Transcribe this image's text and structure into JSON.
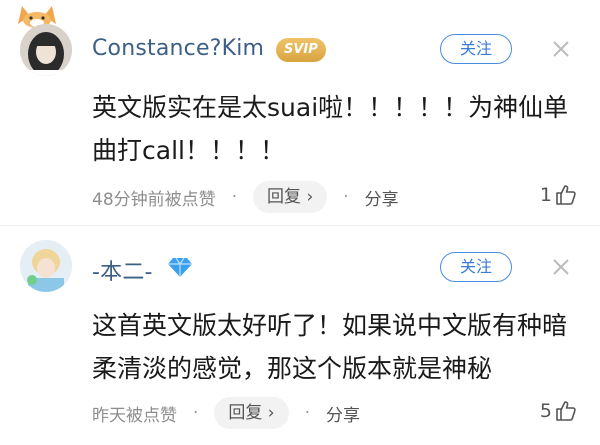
{
  "comments": [
    {
      "username": "Constance?Kim",
      "badge": "SVIP",
      "follow_label": "关注",
      "text": "英文版实在是太suai啦！！！！！为神仙单曲打call！！！！",
      "time": "48分钟前被点赞",
      "reply_label": "回复 ›",
      "share_label": "分享",
      "likes": "1"
    },
    {
      "username": "-本二-",
      "follow_label": "关注",
      "text": "这首英文版太好听了！如果说中文版有种暗柔清淡的感觉，那这个版本就是神秘",
      "time": "昨天被点赞",
      "reply_label": "回复 ›",
      "share_label": "分享",
      "likes": "5"
    }
  ],
  "colors": {
    "username": "#3c5f86",
    "follow_border": "#4a8de0",
    "svip_gold": "#d9a441",
    "meta_gray": "#8e8e8e"
  },
  "icons": [
    "corgi-decoration-icon",
    "vip-diamond-icon",
    "more-options-icon",
    "thumbs-up-icon"
  ]
}
